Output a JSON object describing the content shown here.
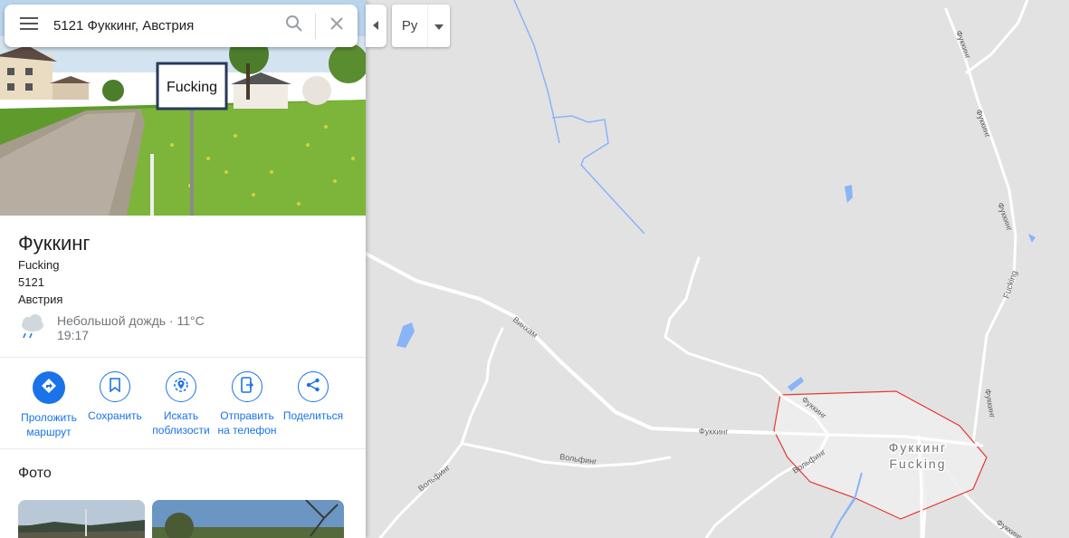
{
  "search": {
    "query": "5121 Фуккинг, Австрия"
  },
  "icons": {
    "menu": "menu-icon",
    "search": "search-icon",
    "clear": "close-icon",
    "collapse": "caret-left-icon",
    "caret": "caret-down-icon",
    "weather": "rain-cloud-icon"
  },
  "hero": {
    "sign_text": "Fucking"
  },
  "place": {
    "title": "Фуккинг",
    "address_lines": [
      "Fucking",
      "5121",
      "Австрия"
    ],
    "weather": {
      "summary": "Небольшой дождь · 11°C",
      "time": "19:17"
    }
  },
  "actions": [
    {
      "label": "Проложить\nмаршрут",
      "icon": "directions-icon"
    },
    {
      "label": "Сохранить",
      "icon": "bookmark-icon"
    },
    {
      "label": "Искать\nпоблизости",
      "icon": "nearby-icon"
    },
    {
      "label": "Отправить\nна телефон",
      "icon": "send-to-phone-icon"
    },
    {
      "label": "Поделиться",
      "icon": "share-icon"
    }
  ],
  "photos": {
    "title": "Фото"
  },
  "language": {
    "label": "Pу"
  },
  "map": {
    "place_label_ru": "Фуккинг",
    "place_label_en": "Fucking",
    "road_labels": {
      "winham": "Винхам",
      "fukking_main": "Фуккинг",
      "wolfing_1": "Вольфинг",
      "wolfing_2": "Вольфинг",
      "wolfing_3": "Вольфинг",
      "fucking_road": "Fucking",
      "fukking_ne_1": "Фуккинг",
      "fukking_ne_2": "Фуккинг",
      "fukking_ne_3": "Фуккинг",
      "fukking_ne_4": "Фуккинг",
      "fukking_town": "Фуккинг",
      "fukking_se": "Фуккинг"
    }
  },
  "colors": {
    "accent": "#1a73e8",
    "boundary": "#e53935",
    "water": "#8ab4f8",
    "map_bg": "#e2e2e2"
  }
}
